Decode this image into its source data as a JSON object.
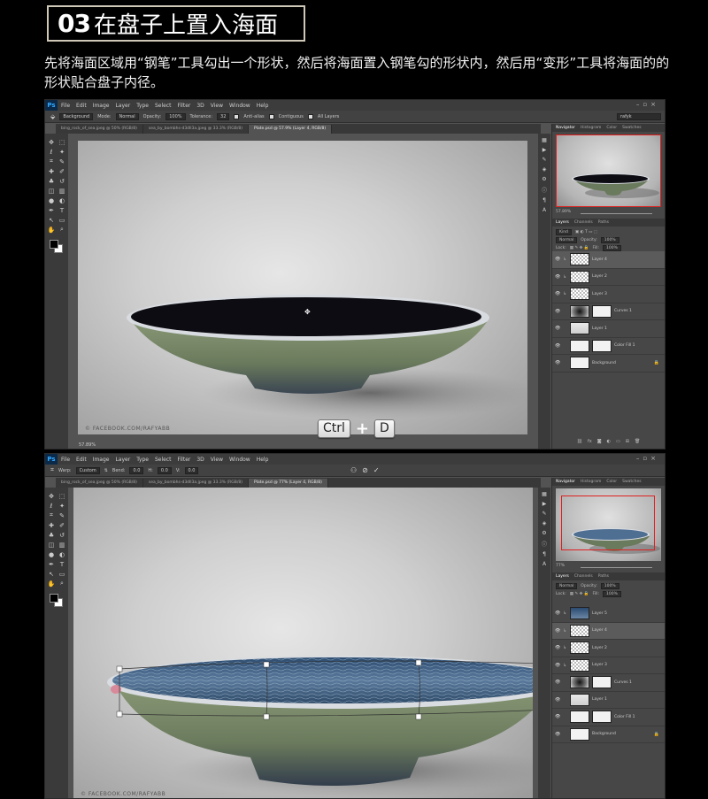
{
  "header": {
    "number": "03",
    "title": "在盘子上置入海面"
  },
  "intro": "先将海面区域用“钢笔”工具勾出一个形状，然后将海面置入钢笔勾的形状内，然后用“变形”工具将海面的的形状贴合盘子内径。",
  "ps1": {
    "logo": "Ps",
    "menu": [
      "File",
      "Edit",
      "Image",
      "Layer",
      "Type",
      "Select",
      "Filter",
      "3D",
      "View",
      "Window",
      "Help"
    ],
    "options": {
      "mode_label": "Mode:",
      "mode": "Normal",
      "opacity_label": "Opacity:",
      "opacity": "100%",
      "tolerance_label": "Tolerance:",
      "tolerance": "32",
      "antialias": "Anti-alias",
      "contiguous": "Contiguous",
      "all_layers": "All Layers",
      "preset": "Background",
      "workspace": "rafyk"
    },
    "tabs": [
      "bing_rock_of_sea.jpeg @ 50% (RGB/8)",
      "sea_by_bombhs-d3dll3a.jpeg @ 33.3% (RGB/8)",
      "Plate.psd @ 57.9% (Layer 4, RGB/8)"
    ],
    "watermark": "© FACEBOOK.COM/RAFYABB",
    "zoom": "57.89%",
    "key1": "Ctrl",
    "key_plus": "+",
    "key2": "D",
    "panel_tabs": [
      "Navigator",
      "Histogram",
      "Color",
      "Swatches"
    ],
    "nav_zoom": "57.89%",
    "layers_tabs": [
      "Layers",
      "Channels",
      "Paths"
    ],
    "kind": "Kind",
    "blend": "Normal",
    "opacity_label": "Opacity:",
    "opacity": "100%",
    "lock_label": "Lock:",
    "fill_label": "Fill:",
    "fill": "100%",
    "layers": [
      {
        "name": "Layer 4",
        "thumb": "chk"
      },
      {
        "name": "Layer 2",
        "thumb": "chk"
      },
      {
        "name": "Layer 3",
        "thumb": "chk"
      },
      {
        "name": "Curves 1",
        "thumb": "grad"
      },
      {
        "name": "Layer 1",
        "thumb": "light"
      },
      {
        "name": "Color Fill 1",
        "thumb": "white"
      },
      {
        "name": "Background",
        "thumb": "white"
      }
    ]
  },
  "ps2": {
    "logo": "Ps",
    "menu": [
      "File",
      "Edit",
      "Image",
      "Layer",
      "Type",
      "Select",
      "Filter",
      "3D",
      "View",
      "Window",
      "Help"
    ],
    "options": {
      "warp_label": "Warp:",
      "warp": "Custom",
      "bend_label": "Bend:",
      "bend": "0.0",
      "h_label": "H:",
      "h": "0.0",
      "v_label": "V:",
      "v": "0.0"
    },
    "tabs": [
      "bing_rock_of_sea.jpeg @ 50% (RGB/8)",
      "sea_by_bombhs-d3dll3a.jpeg @ 33.3% (RGB/8)",
      "Plate.psd @ 77% (Layer 4, RGB/8)"
    ],
    "watermark": "© FACEBOOK.COM/RAFYABB",
    "zoom": "77%",
    "panel_tabs": [
      "Navigator",
      "Histogram",
      "Color",
      "Swatches"
    ],
    "nav_zoom": "77%",
    "layers_tabs": [
      "Layers",
      "Channels",
      "Paths"
    ],
    "blend": "Normal",
    "opacity_label": "Opacity:",
    "opacity": "100%",
    "lock_label": "Lock:",
    "fill_label": "Fill:",
    "fill": "100%",
    "layers": [
      {
        "name": "Layer 5",
        "thumb": "sea"
      },
      {
        "name": "Layer 4",
        "thumb": "chk"
      },
      {
        "name": "Layer 2",
        "thumb": "chk"
      },
      {
        "name": "Layer 3",
        "thumb": "chk"
      },
      {
        "name": "Curves 1",
        "thumb": "grad"
      },
      {
        "name": "Layer 1",
        "thumb": "light"
      },
      {
        "name": "Color Fill 1",
        "thumb": "white"
      },
      {
        "name": "Background",
        "thumb": "white"
      }
    ]
  },
  "icons": {
    "tools": [
      "move-icon",
      "marquee-icon",
      "lasso-icon",
      "magic-wand-icon",
      "crop-icon",
      "eyedropper-icon",
      "heal-icon",
      "brush-icon",
      "stamp-icon",
      "history-brush-icon",
      "eraser-icon",
      "gradient-icon",
      "blur-icon",
      "dodge-icon",
      "pen-icon",
      "type-icon",
      "path-select-icon",
      "shape-icon",
      "hand-icon",
      "zoom-icon"
    ],
    "glyphs": [
      "✥",
      "⬚",
      "ℓ",
      "✦",
      "⌗",
      "✎",
      "✚",
      "✐",
      "♣",
      "↺",
      "◫",
      "▥",
      "●",
      "◐",
      "✒",
      "T",
      "↖",
      "▭",
      "✋",
      "⌕"
    ]
  }
}
